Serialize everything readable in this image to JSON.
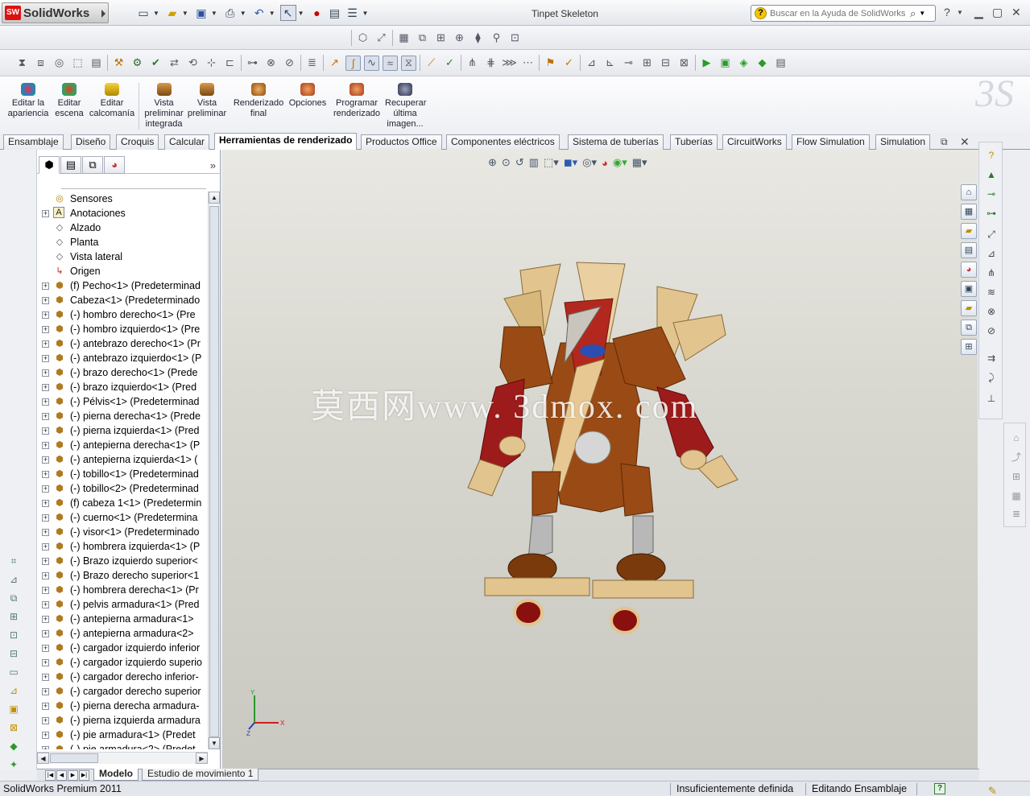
{
  "app": {
    "logo_text": "SolidWorks",
    "logo_mark": "SW",
    "window_title": "Tinpet Skeleton"
  },
  "help_search": {
    "placeholder": "Buscar en la Ayuda de SolidWorks"
  },
  "command_manager": {
    "commands": [
      {
        "label": "Editar la apariencia",
        "color": "#2a7bd0"
      },
      {
        "label": "Editar escena",
        "color": "#3aa34a"
      },
      {
        "label": "Editar calcomanía",
        "color": "#d8b000"
      },
      {
        "label": "Vista preliminar integrada",
        "color": "#b06a00"
      },
      {
        "label": "Vista preliminar",
        "color": "#b06a00"
      },
      {
        "label": "Renderizado final",
        "color": "#c27a28"
      },
      {
        "label": "Opciones",
        "color": "#c84a2a"
      },
      {
        "label": "Programar renderizado",
        "color": "#c84a2a"
      },
      {
        "label": "Recuperar última imagen...",
        "color": "#444c66"
      }
    ]
  },
  "tabs": [
    {
      "label": "Ensamblaje"
    },
    {
      "label": "Diseño"
    },
    {
      "label": "Croquis"
    },
    {
      "label": "Calcular"
    },
    {
      "label": "Herramientas de renderizado"
    },
    {
      "label": "Productos Office"
    },
    {
      "label": "Componentes eléctricos"
    },
    {
      "label": "Sistema de tuberías"
    },
    {
      "label": "Tuberías"
    },
    {
      "label": "CircuitWorks"
    },
    {
      "label": "Flow Simulation"
    },
    {
      "label": "Simulation"
    }
  ],
  "active_tab": "Herramientas de renderizado",
  "tree": [
    {
      "label": "Sensores",
      "icon": "sensor-icon",
      "expander": false
    },
    {
      "label": "Anotaciones",
      "icon": "annotations-icon",
      "expander": true
    },
    {
      "label": "Alzado",
      "icon": "plane-icon",
      "expander": false
    },
    {
      "label": "Planta",
      "icon": "plane-icon",
      "expander": false
    },
    {
      "label": "Vista lateral",
      "icon": "plane-icon",
      "expander": false
    },
    {
      "label": "Origen",
      "icon": "origin-icon",
      "expander": false
    },
    {
      "label": "(f) Pecho<1> (Predeterminad",
      "icon": "part-icon",
      "expander": true
    },
    {
      "label": "Cabeza<1> (Predeterminado",
      "icon": "part-icon",
      "expander": true
    },
    {
      "label": "(-) hombro derecho<1> (Pre",
      "icon": "part-icon",
      "expander": true
    },
    {
      "label": "(-) hombro izquierdo<1> (Pre",
      "icon": "part-icon",
      "expander": true
    },
    {
      "label": "(-) antebrazo derecho<1> (Pr",
      "icon": "part-icon",
      "expander": true
    },
    {
      "label": "(-) antebrazo izquierdo<1> (P",
      "icon": "part-icon",
      "expander": true
    },
    {
      "label": "(-) brazo derecho<1> (Prede",
      "icon": "part-icon",
      "expander": true
    },
    {
      "label": "(-) brazo izquierdo<1> (Pred",
      "icon": "part-icon",
      "expander": true
    },
    {
      "label": "(-) Pélvis<1> (Predeterminad",
      "icon": "part-icon",
      "expander": true
    },
    {
      "label": "(-) pierna derecha<1> (Prede",
      "icon": "part-icon",
      "expander": true
    },
    {
      "label": "(-) pierna izquierda<1> (Pred",
      "icon": "part-icon",
      "expander": true
    },
    {
      "label": "(-) antepierna derecha<1> (P",
      "icon": "part-icon",
      "expander": true
    },
    {
      "label": "(-) antepierna izquierda<1> (",
      "icon": "part-icon",
      "expander": true
    },
    {
      "label": "(-) tobillo<1> (Predeterminad",
      "icon": "part-icon",
      "expander": true
    },
    {
      "label": "(-) tobillo<2> (Predeterminad",
      "icon": "part-icon",
      "expander": true
    },
    {
      "label": "(f) cabeza 1<1> (Predetermin",
      "icon": "part-icon",
      "expander": true
    },
    {
      "label": "(-) cuerno<1> (Predetermina",
      "icon": "part-icon",
      "expander": true
    },
    {
      "label": "(-) visor<1> (Predeterminado",
      "icon": "part-icon",
      "expander": true
    },
    {
      "label": "(-) hombrera izquierda<1> (P",
      "icon": "part-icon",
      "expander": true
    },
    {
      "label": "(-) Brazo izquierdo superior<",
      "icon": "part-icon",
      "expander": true
    },
    {
      "label": "(-) Brazo derecho superior<1",
      "icon": "part-icon",
      "expander": true
    },
    {
      "label": "(-) hombrera derecha<1> (Pr",
      "icon": "part-icon",
      "expander": true
    },
    {
      "label": "(-) pelvis armadura<1> (Pred",
      "icon": "part-icon",
      "expander": true
    },
    {
      "label": "(-) antepierna armadura<1>",
      "icon": "part-icon",
      "expander": true
    },
    {
      "label": "(-) antepierna armadura<2>",
      "icon": "part-icon",
      "expander": true
    },
    {
      "label": "(-) cargador izquierdo inferior",
      "icon": "part-icon",
      "expander": true
    },
    {
      "label": "(-) cargador izquierdo superio",
      "icon": "part-icon",
      "expander": true
    },
    {
      "label": "(-) cargador derecho inferior-",
      "icon": "part-icon",
      "expander": true
    },
    {
      "label": "(-) cargador derecho superior",
      "icon": "part-icon",
      "expander": true
    },
    {
      "label": "(-) pierna derecha armadura-",
      "icon": "part-icon",
      "expander": true
    },
    {
      "label": "(-) pierna izquierda armadura",
      "icon": "part-icon",
      "expander": true
    },
    {
      "label": "(-) pie armadura<1> (Predet",
      "icon": "part-icon",
      "expander": true
    },
    {
      "label": "(-) pie armadura<2> (Predet",
      "icon": "part-icon",
      "expander": true
    }
  ],
  "viewport": {
    "watermark": "莫西网www. 3dmox. com",
    "triad": {
      "x": "X",
      "y": "Y",
      "z": "Z"
    }
  },
  "bottom_tabs": [
    {
      "label": "Modelo"
    },
    {
      "label": "Estudio de movimiento 1"
    }
  ],
  "active_bottom_tab": "Modelo",
  "status": {
    "product": "SolidWorks Premium 2011",
    "definition": "Insuficientemente definida",
    "mode": "Editando Ensamblaje",
    "help": "?"
  },
  "colors": {
    "accent_red": "#c8102e",
    "tab_border": "#7f9db9",
    "robot_red": "#9e1b1b",
    "robot_wood": "#e3c48f",
    "robot_brown": "#8a4213"
  }
}
